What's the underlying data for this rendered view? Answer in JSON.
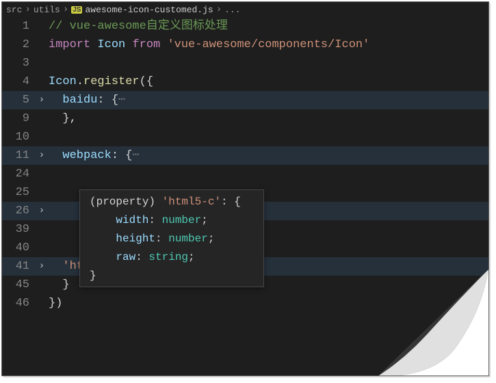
{
  "breadcrumb": {
    "root": "src",
    "folder": "utils",
    "js_badge": "JS",
    "file": "awesome-icon-customed.js",
    "tail": "..."
  },
  "lines": [
    {
      "num": "1",
      "fold": "",
      "hl": false,
      "segs": [
        {
          "cls": "c-comment",
          "t": "// vue-awesome自定义图标处理"
        }
      ]
    },
    {
      "num": "2",
      "fold": "",
      "hl": false,
      "segs": [
        {
          "cls": "c-keyword",
          "t": "import"
        },
        {
          "cls": "",
          "t": " "
        },
        {
          "cls": "c-var",
          "t": "Icon"
        },
        {
          "cls": "",
          "t": " "
        },
        {
          "cls": "c-keyword",
          "t": "from"
        },
        {
          "cls": "",
          "t": " "
        },
        {
          "cls": "c-string",
          "t": "'vue-awesome/components/Icon'"
        }
      ]
    },
    {
      "num": "3",
      "fold": "",
      "hl": false,
      "segs": []
    },
    {
      "num": "4",
      "fold": "",
      "hl": false,
      "segs": [
        {
          "cls": "c-var",
          "t": "Icon"
        },
        {
          "cls": "c-punct",
          "t": "."
        },
        {
          "cls": "c-func",
          "t": "register"
        },
        {
          "cls": "c-punct",
          "t": "({"
        }
      ]
    },
    {
      "num": "5",
      "fold": ">",
      "hl": true,
      "segs": [
        {
          "cls": "",
          "t": "  "
        },
        {
          "cls": "c-var",
          "t": "baidu"
        },
        {
          "cls": "c-punct",
          "t": ": {"
        },
        {
          "cls": "c-fold",
          "t": "⋯"
        }
      ]
    },
    {
      "num": "9",
      "fold": "",
      "hl": false,
      "segs": [
        {
          "cls": "",
          "t": "  "
        },
        {
          "cls": "c-punct",
          "t": "},"
        }
      ]
    },
    {
      "num": "10",
      "fold": "",
      "hl": false,
      "segs": []
    },
    {
      "num": "11",
      "fold": ">",
      "hl": true,
      "segs": [
        {
          "cls": "",
          "t": "  "
        },
        {
          "cls": "c-var",
          "t": "webpack"
        },
        {
          "cls": "c-punct",
          "t": ": {"
        },
        {
          "cls": "c-fold",
          "t": "⋯"
        }
      ]
    },
    {
      "num": "24",
      "fold": "",
      "hl": false,
      "segs": []
    },
    {
      "num": "25",
      "fold": "",
      "hl": false,
      "segs": []
    },
    {
      "num": "26",
      "fold": ">",
      "hl": true,
      "segs": []
    },
    {
      "num": "39",
      "fold": "",
      "hl": false,
      "segs": []
    },
    {
      "num": "40",
      "fold": "",
      "hl": false,
      "segs": []
    },
    {
      "num": "41",
      "fold": ">",
      "hl": true,
      "segs": [
        {
          "cls": "",
          "t": "  "
        },
        {
          "cls": "c-string",
          "t": "'html5-c'"
        },
        {
          "cls": "c-punct",
          "t": ": {"
        },
        {
          "cls": "c-fold",
          "t": "⋯"
        }
      ]
    },
    {
      "num": "45",
      "fold": "",
      "hl": false,
      "segs": [
        {
          "cls": "",
          "t": "  "
        },
        {
          "cls": "c-punct",
          "t": "}"
        }
      ]
    },
    {
      "num": "46",
      "fold": "",
      "hl": false,
      "segs": [
        {
          "cls": "c-punct",
          "t": "})"
        }
      ]
    }
  ],
  "hover": {
    "l1_a": "(property) ",
    "l1_b": "'html5-c'",
    "l1_c": ": {",
    "l2_a": "    ",
    "l2_b": "width",
    "l2_c": ": ",
    "l2_d": "number",
    "l2_e": ";",
    "l3_a": "    ",
    "l3_b": "height",
    "l3_c": ": ",
    "l3_d": "number",
    "l3_e": ";",
    "l4_a": "    ",
    "l4_b": "raw",
    "l4_c": ": ",
    "l4_d": "string",
    "l4_e": ";",
    "l5": "}"
  }
}
